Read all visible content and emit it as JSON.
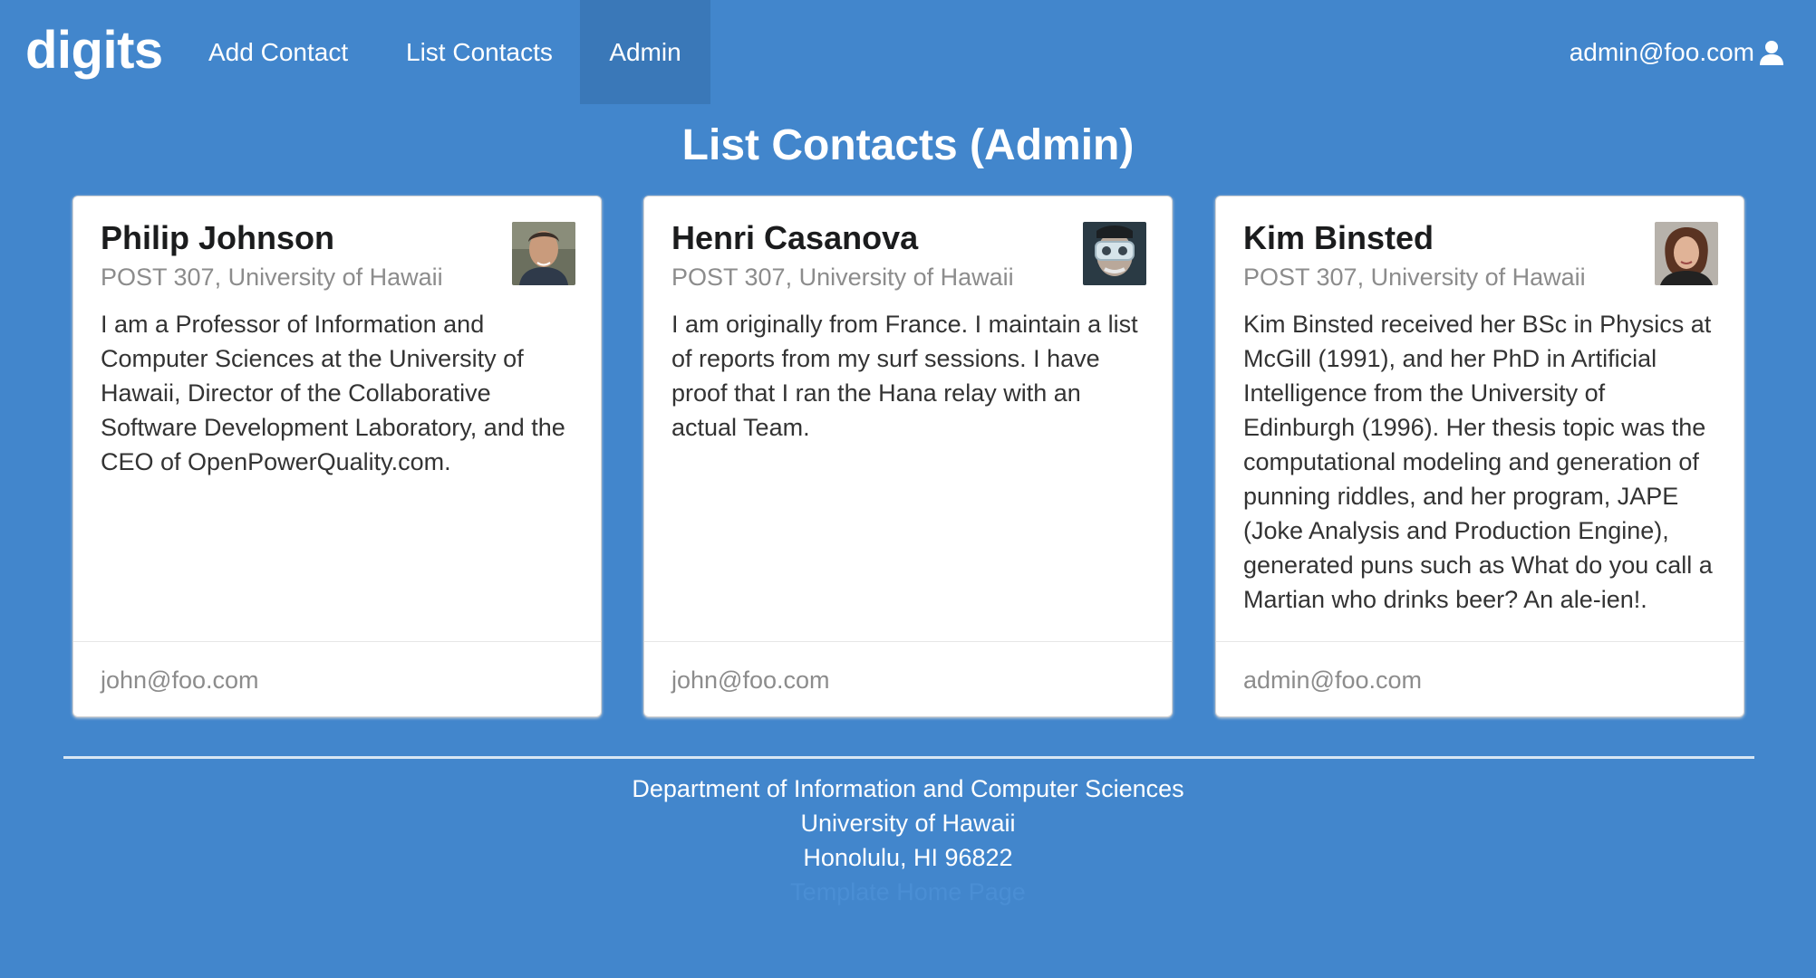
{
  "navbar": {
    "brand": "digits",
    "items": [
      {
        "label": "Add Contact"
      },
      {
        "label": "List Contacts"
      },
      {
        "label": "Admin"
      }
    ],
    "user": "admin@foo.com",
    "active_bg": "#3a78b8"
  },
  "page": {
    "title": "List Contacts (Admin)",
    "background": "#4286cc"
  },
  "contacts": [
    {
      "name": "Philip Johnson",
      "address": "POST 307, University of Hawaii",
      "description": "I am a Professor of Information and Computer Sciences at the University of Hawaii, Director of the Collaborative Software Development Laboratory, and the CEO of OpenPowerQuality.com.",
      "owner": "john@foo.com",
      "avatar_icon": "portrait-photo-icon"
    },
    {
      "name": "Henri Casanova",
      "address": "POST 307, University of Hawaii",
      "description": "I am originally from France. I maintain a list of reports from my surf sessions. I have proof that I ran the Hana relay with an actual Team.",
      "owner": "john@foo.com",
      "avatar_icon": "portrait-photo-icon"
    },
    {
      "name": "Kim Binsted",
      "address": "POST 307, University of Hawaii",
      "description": "Kim Binsted received her BSc in Physics at McGill (1991), and her PhD in Artificial Intelligence from the University of Edinburgh (1996). Her thesis topic was the computational modeling and generation of punning riddles, and her program, JAPE (Joke Analysis and Production Engine), generated puns such as What do you call a Martian who drinks beer? An ale-ien!.",
      "owner": "admin@foo.com",
      "avatar_icon": "portrait-photo-icon"
    }
  ],
  "footer": {
    "line1": "Department of Information and Computer Sciences",
    "line2": "University of Hawaii",
    "line3": "Honolulu, HI 96822",
    "link": "Template Home Page"
  }
}
